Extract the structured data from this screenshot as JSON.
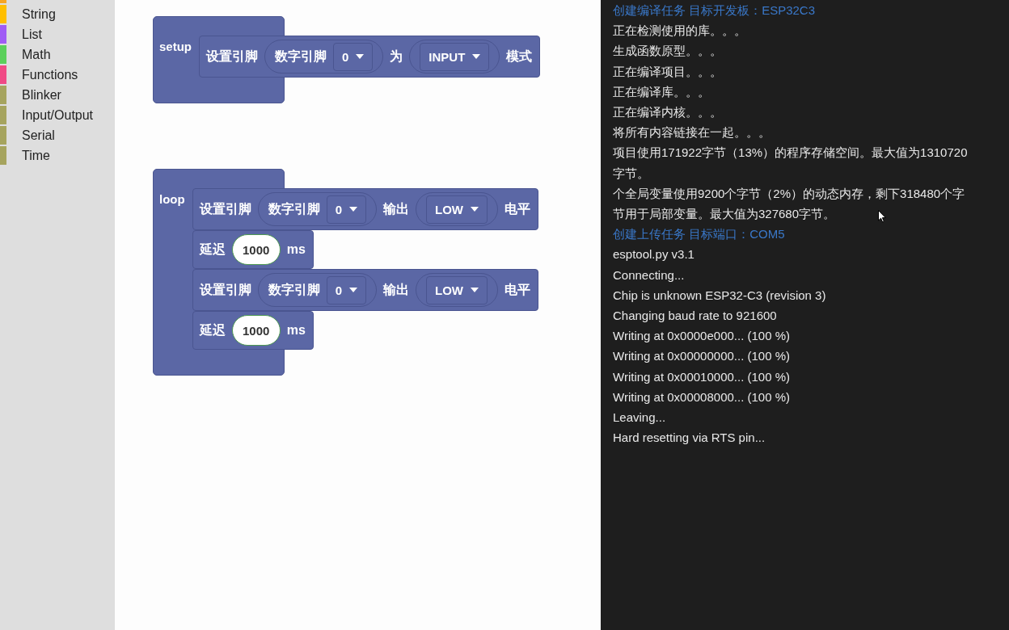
{
  "toolbox": {
    "partial_item": {
      "color": "#f7a524"
    },
    "items": [
      {
        "label": "String",
        "color": "#ffbf00"
      },
      {
        "label": "List",
        "color": "#a05cf5"
      },
      {
        "label": "Math",
        "color": "#5bd05b"
      },
      {
        "label": "Functions",
        "color": "#f04a85"
      },
      {
        "label": "Blinker",
        "color": "#a6a45e"
      },
      {
        "label": "Input/Output",
        "color": "#a6a45e"
      },
      {
        "label": "Serial",
        "color": "#a6a45e"
      },
      {
        "label": "Time",
        "color": "#a6a45e"
      }
    ]
  },
  "workspace": {
    "blocks": [
      {
        "label": "setup",
        "statements": [
          {
            "parts": [
              {
                "kind": "text",
                "text": "设置引脚"
              },
              {
                "kind": "input",
                "parts": [
                  {
                    "kind": "text",
                    "text": "数字引脚"
                  },
                  {
                    "kind": "dropdown",
                    "value": "0"
                  }
                ]
              },
              {
                "kind": "text",
                "text": "为"
              },
              {
                "kind": "input",
                "parts": [
                  {
                    "kind": "dropdown",
                    "value": "INPUT"
                  }
                ]
              },
              {
                "kind": "text",
                "text": "模式"
              }
            ]
          }
        ]
      },
      {
        "label": "loop",
        "statements": [
          {
            "parts": [
              {
                "kind": "text",
                "text": "设置引脚"
              },
              {
                "kind": "input",
                "parts": [
                  {
                    "kind": "text",
                    "text": "数字引脚"
                  },
                  {
                    "kind": "dropdown",
                    "value": "0"
                  }
                ]
              },
              {
                "kind": "text",
                "text": "输出"
              },
              {
                "kind": "input",
                "parts": [
                  {
                    "kind": "dropdown",
                    "value": "LOW"
                  }
                ]
              },
              {
                "kind": "text",
                "text": "电平"
              }
            ]
          },
          {
            "parts": [
              {
                "kind": "text",
                "text": "延迟"
              },
              {
                "kind": "number",
                "value": "1000"
              },
              {
                "kind": "text",
                "text": "ms"
              }
            ]
          },
          {
            "parts": [
              {
                "kind": "text",
                "text": "设置引脚"
              },
              {
                "kind": "input",
                "parts": [
                  {
                    "kind": "text",
                    "text": "数字引脚"
                  },
                  {
                    "kind": "dropdown",
                    "value": "0"
                  }
                ]
              },
              {
                "kind": "text",
                "text": "输出"
              },
              {
                "kind": "input",
                "parts": [
                  {
                    "kind": "dropdown",
                    "value": "LOW"
                  }
                ]
              },
              {
                "kind": "text",
                "text": "电平"
              }
            ]
          },
          {
            "parts": [
              {
                "kind": "text",
                "text": "延迟"
              },
              {
                "kind": "number",
                "value": "1000"
              },
              {
                "kind": "text",
                "text": "ms"
              }
            ]
          }
        ]
      }
    ]
  },
  "console": {
    "lines": [
      {
        "kind": "task",
        "text": "创建编译任务 目标开发板：ESP32C3"
      },
      {
        "kind": "log",
        "text": "正在检测使用的库。。。"
      },
      {
        "kind": "log",
        "text": "生成函数原型。。。"
      },
      {
        "kind": "log",
        "text": "正在编译项目。。。"
      },
      {
        "kind": "log",
        "text": "正在编译库。。。"
      },
      {
        "kind": "log",
        "text": "正在编译内核。。。"
      },
      {
        "kind": "log",
        "text": "将所有内容链接在一起。。。"
      },
      {
        "kind": "log",
        "text": "项目使用171922字节（13%）的程序存储空间。最大值为1310720"
      },
      {
        "kind": "log",
        "text": "字节。"
      },
      {
        "kind": "log",
        "text": "个全局变量使用9200个字节（2%）的动态内存，剩下318480个字"
      },
      {
        "kind": "log",
        "text": "节用于局部变量。最大值为327680字节。"
      },
      {
        "kind": "task",
        "text": "创建上传任务 目标端口：COM5"
      },
      {
        "kind": "log",
        "text": "esptool.py v3.1"
      },
      {
        "kind": "log",
        "text": "Connecting..."
      },
      {
        "kind": "log",
        "text": "Chip is unknown ESP32-C3 (revision 3)"
      },
      {
        "kind": "log",
        "text": "Changing baud rate to 921600"
      },
      {
        "kind": "log",
        "text": "Writing at 0x0000e000... (100 %)"
      },
      {
        "kind": "log",
        "text": "Writing at 0x00000000... (100 %)"
      },
      {
        "kind": "log",
        "text": "Writing at 0x00010000... (100 %)"
      },
      {
        "kind": "log",
        "text": "Writing at 0x00008000... (100 %)"
      },
      {
        "kind": "log",
        "text": "Leaving..."
      },
      {
        "kind": "log",
        "text": "Hard resetting via RTS pin..."
      }
    ]
  }
}
